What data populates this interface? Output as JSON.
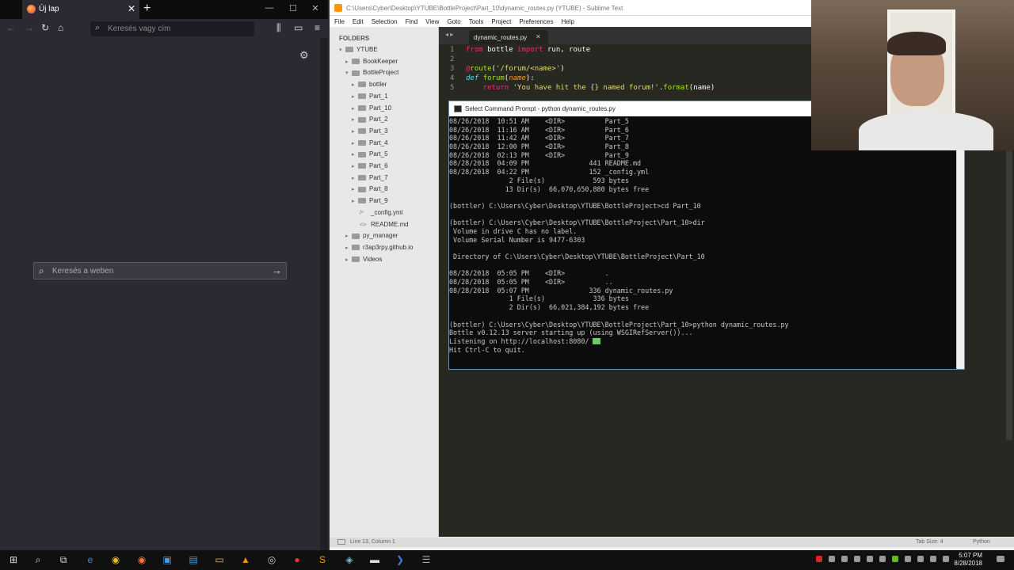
{
  "firefox": {
    "tab_title": "Új lap",
    "url_placeholder": "Keresés vagy cím",
    "search_placeholder": "Keresés a weben"
  },
  "sublime": {
    "window_title": "C:\\Users\\Cyber\\Desktop\\YTUBE\\BottleProject\\Part_10\\dynamic_routes.py (YTUBE) - Sublime Text",
    "menu": [
      "File",
      "Edit",
      "Selection",
      "Find",
      "View",
      "Goto",
      "Tools",
      "Project",
      "Preferences",
      "Help"
    ],
    "folders_header": "FOLDERS",
    "tab_name": "dynamic_routes.py",
    "tree": [
      {
        "label": "YTUBE",
        "depth": 0,
        "open": true,
        "type": "folder"
      },
      {
        "label": "BookKeeper",
        "depth": 1,
        "open": false,
        "type": "folder"
      },
      {
        "label": "BottleProject",
        "depth": 1,
        "open": true,
        "type": "folder"
      },
      {
        "label": "bottler",
        "depth": 2,
        "open": false,
        "type": "folder"
      },
      {
        "label": "Part_1",
        "depth": 2,
        "open": false,
        "type": "folder"
      },
      {
        "label": "Part_10",
        "depth": 2,
        "open": false,
        "type": "folder"
      },
      {
        "label": "Part_2",
        "depth": 2,
        "open": false,
        "type": "folder"
      },
      {
        "label": "Part_3",
        "depth": 2,
        "open": false,
        "type": "folder"
      },
      {
        "label": "Part_4",
        "depth": 2,
        "open": false,
        "type": "folder"
      },
      {
        "label": "Part_5",
        "depth": 2,
        "open": false,
        "type": "folder"
      },
      {
        "label": "Part_6",
        "depth": 2,
        "open": false,
        "type": "folder"
      },
      {
        "label": "Part_7",
        "depth": 2,
        "open": false,
        "type": "folder"
      },
      {
        "label": "Part_8",
        "depth": 2,
        "open": false,
        "type": "folder"
      },
      {
        "label": "Part_9",
        "depth": 2,
        "open": false,
        "type": "folder"
      },
      {
        "label": "_config.yml",
        "depth": 2,
        "type": "file",
        "icon": "/*"
      },
      {
        "label": "README.md",
        "depth": 2,
        "type": "file",
        "icon": "<>"
      },
      {
        "label": "py_manager",
        "depth": 1,
        "open": false,
        "type": "folder"
      },
      {
        "label": "r3ap3rpy.github.io",
        "depth": 1,
        "open": false,
        "type": "folder"
      },
      {
        "label": "Videos",
        "depth": 1,
        "open": false,
        "type": "folder"
      }
    ],
    "line_numbers": [
      "1",
      "2",
      "3",
      "4",
      "5"
    ],
    "status_left": "Line 13, Column 1",
    "status_tab": "Tab Size: 4",
    "status_syntax": "Python"
  },
  "cmd": {
    "title": "Select Command Prompt - python  dynamic_routes.py",
    "lines": [
      "08/26/2018  10:51 AM    <DIR>          Part_5",
      "08/26/2018  11:16 AM    <DIR>          Part_6",
      "08/26/2018  11:42 AM    <DIR>          Part_7",
      "08/26/2018  12:00 PM    <DIR>          Part_8",
      "08/26/2018  02:13 PM    <DIR>          Part_9",
      "08/28/2018  04:09 PM               441 README.md",
      "08/28/2018  04:22 PM               152 _config.yml",
      "               2 File(s)            593 bytes",
      "              13 Dir(s)  66,070,650,880 bytes free",
      "",
      "(bottler) C:\\Users\\Cyber\\Desktop\\YTUBE\\BottleProject>cd Part_10",
      "",
      "(bottler) C:\\Users\\Cyber\\Desktop\\YTUBE\\BottleProject\\Part_10>dir",
      " Volume in drive C has no label.",
      " Volume Serial Number is 9477-6303",
      "",
      " Directory of C:\\Users\\Cyber\\Desktop\\YTUBE\\BottleProject\\Part_10",
      "",
      "08/28/2018  05:05 PM    <DIR>          .",
      "08/28/2018  05:05 PM    <DIR>          ..",
      "08/28/2018  05:07 PM               336 dynamic_routes.py",
      "               1 File(s)            336 bytes",
      "               2 Dir(s)  66,021,384,192 bytes free",
      "",
      "(bottler) C:\\Users\\Cyber\\Desktop\\YTUBE\\BottleProject\\Part_10>python dynamic_routes.py",
      "Bottle v0.12.13 server starting up (using WSGIRefServer())...",
      "Listening on http://localhost:8080/",
      "Hit Ctrl-C to quit."
    ]
  },
  "taskbar": {
    "time": "5:07 PM",
    "date": "8/28/2018"
  }
}
